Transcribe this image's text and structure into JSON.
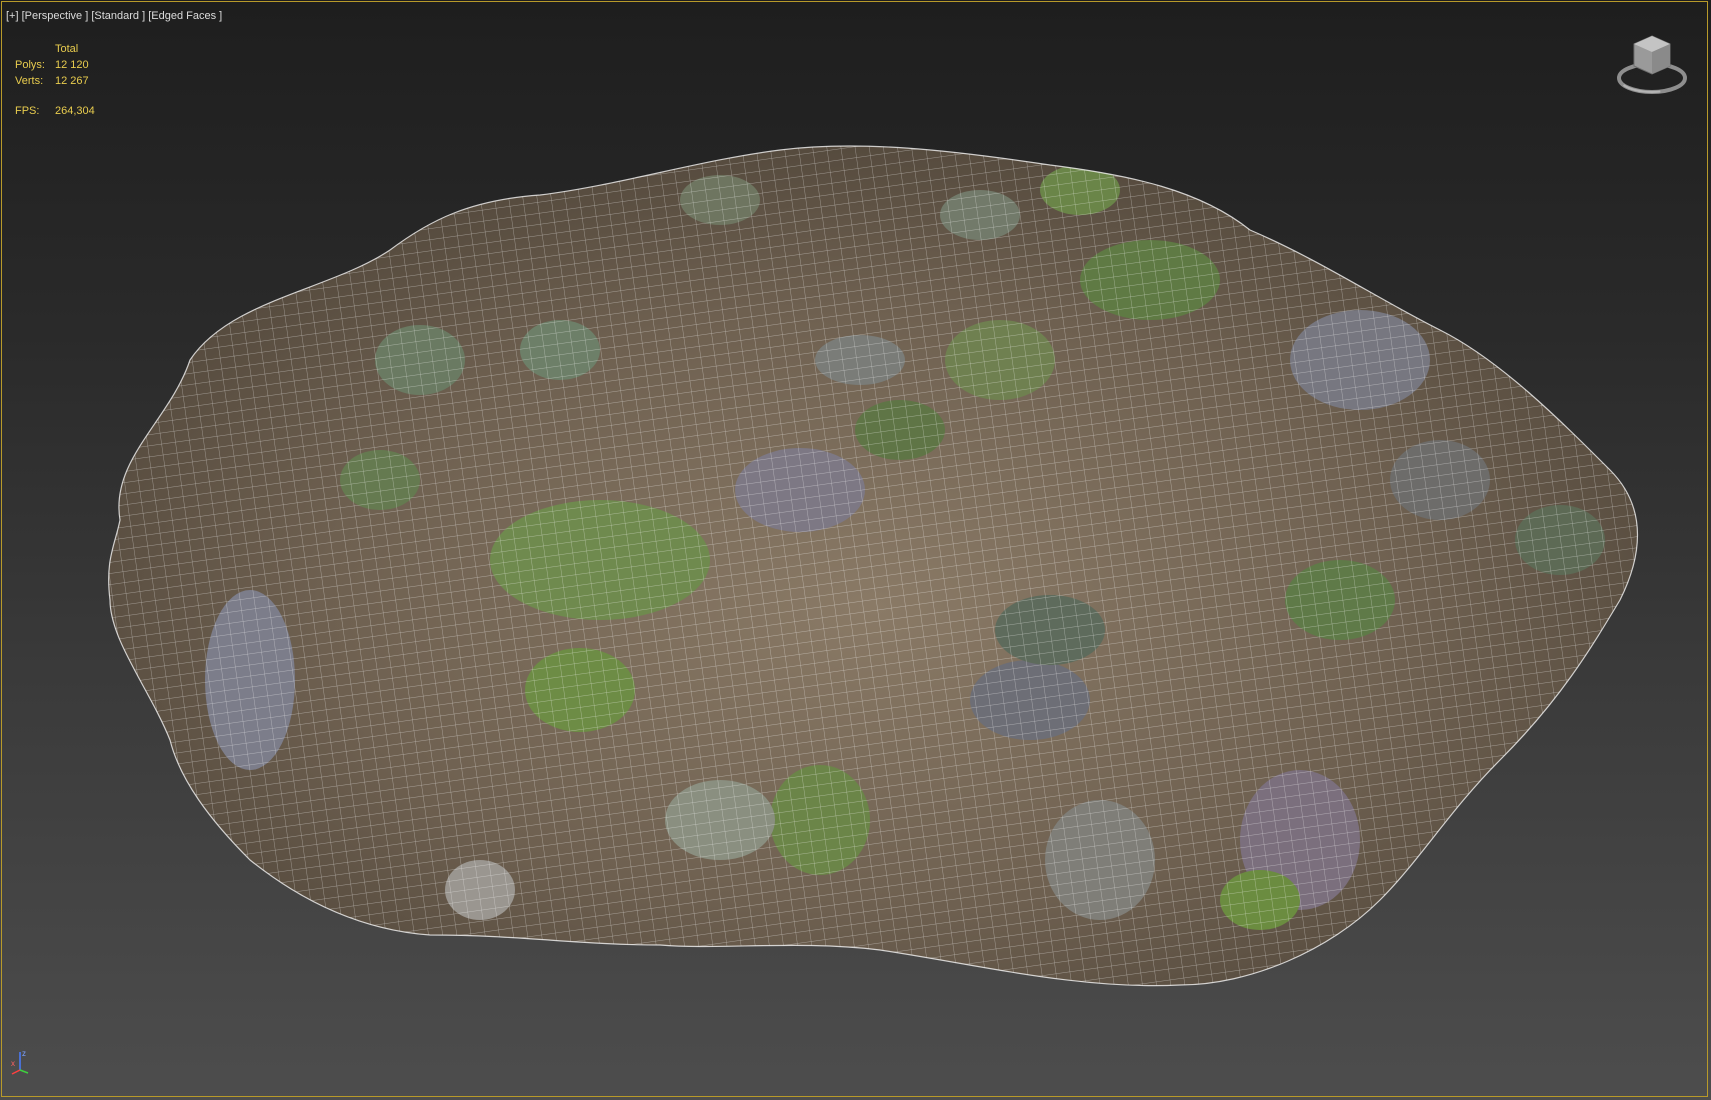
{
  "viewport": {
    "label_parts": [
      "[+]",
      "[Perspective ]",
      "[Standard ]",
      "[Edged Faces ]"
    ]
  },
  "stats": {
    "header": "Total",
    "polys_label": "Polys:",
    "polys_value": "12 120",
    "verts_label": "Verts:",
    "verts_value": "12 267",
    "fps_label": "FPS:",
    "fps_value": "264,304"
  },
  "axis": {
    "x": "x",
    "z": "z"
  },
  "colors": {
    "stats_text": "#e8cc4e",
    "border": "#b89a2a",
    "wire": "#ffffff"
  },
  "icons": [
    "viewcube-icon",
    "axis-tripod-icon"
  ]
}
